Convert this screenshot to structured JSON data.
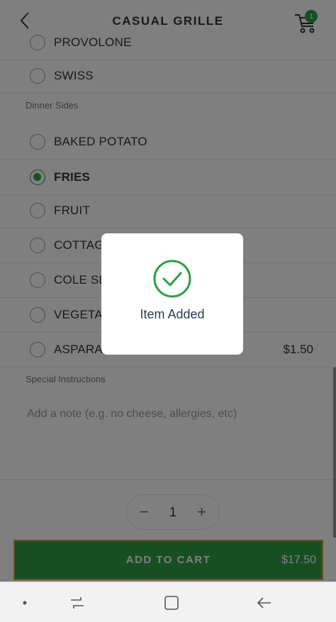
{
  "header": {
    "title": "CASUAL GRILLE",
    "cart_count": "1"
  },
  "options_top": [
    {
      "label": "PROVOLONE",
      "checked": false
    },
    {
      "label": "SWISS",
      "checked": false
    }
  ],
  "dinner_sides": {
    "label": "Dinner Sides",
    "items": [
      {
        "label": "BAKED POTATO",
        "checked": false,
        "price": ""
      },
      {
        "label": "FRIES",
        "checked": true,
        "price": ""
      },
      {
        "label": "FRUIT",
        "checked": false,
        "price": ""
      },
      {
        "label": "COTTAGE CHZ",
        "checked": false,
        "price": ""
      },
      {
        "label": "COLE SLAW",
        "checked": false,
        "price": ""
      },
      {
        "label": "VEGETABLES",
        "checked": false,
        "price": ""
      },
      {
        "label": "ASPARAGUS",
        "checked": false,
        "price": "$1.50"
      }
    ]
  },
  "special_instructions": {
    "label": "Special Instructions",
    "placeholder": "Add a note (e.g. no cheese, allergies, etc)"
  },
  "quantity": {
    "minus": "−",
    "value": "1",
    "plus": "+"
  },
  "add_to_cart": {
    "label": "ADD TO CART",
    "price": "$17.50"
  },
  "modal": {
    "text": "Item Added"
  },
  "colors": {
    "accent": "#2f9e44",
    "button_border": "#c8a63a"
  },
  "icons": {
    "back": "chevron-left-icon",
    "cart": "cart-icon",
    "check": "check-circle-icon"
  }
}
